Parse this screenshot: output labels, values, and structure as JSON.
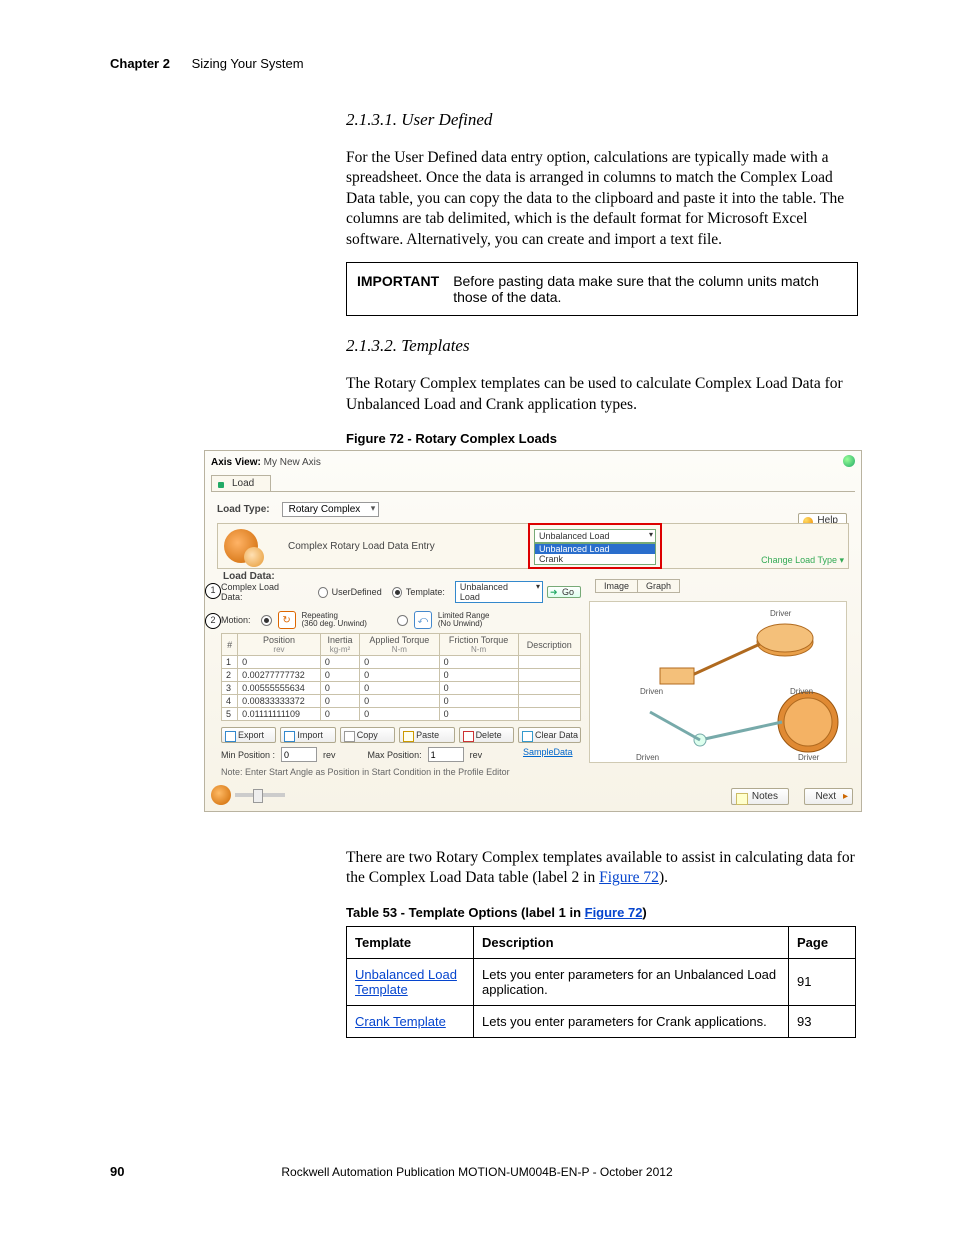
{
  "header": {
    "chapter": "Chapter 2",
    "title": "Sizing Your System"
  },
  "sec1": {
    "num_title": "2.1.3.1.    User Defined",
    "para": "For the User Defined data entry option, calculations are typically made with a spreadsheet. Once the data is arranged in columns to match the Complex Load Data table, you can copy the data to the clipboard and paste it into the table. The columns are tab delimited, which is the default format for Microsoft Excel software. Alternatively, you can create and import a text file."
  },
  "important": {
    "label": "IMPORTANT",
    "text": "Before pasting data make sure that the column units match those of the data."
  },
  "sec2": {
    "num_title": "2.1.3.2.    Templates",
    "para": "The Rotary Complex templates can be used to calculate Complex Load Data for Unbalanced Load and Crank application types."
  },
  "figcap": "Figure 72 - Rotary Complex Loads",
  "screenshot": {
    "axis_view_label": "Axis View:",
    "axis_view_value": "My New Axis",
    "tab_load": "Load",
    "load_type_label": "Load Type:",
    "load_type_value": "Rotary Complex",
    "help_btn": "Help",
    "panel_title": "Complex Rotary Load Data Entry",
    "dd_selected": "Unbalanced Load",
    "dd_opt1": "Unbalanced Load",
    "dd_opt2": "Crank",
    "change_load_type": "Change Load Type",
    "load_data_label": "Load Data:",
    "complex_label": "Complex Load Data:",
    "radio_user": "UserDefined",
    "radio_tmpl": "Template:",
    "tmpl_value": "Unbalanced Load",
    "go_btn": "Go",
    "img_tab": "Image",
    "graph_tab": "Graph",
    "motion_label": "Motion:",
    "repeating_t": "Repeating",
    "repeating_s": "(360 deg. Unwind)",
    "limited_t": "Limited Range",
    "limited_s": "(No Unwind)",
    "cols": {
      "idx": "#",
      "pos": "Position",
      "pos_u": "rev",
      "ine": "Inertia",
      "ine_u": "kg-m²",
      "apt": "Applied Torque",
      "apt_u": "N-m",
      "frt": "Friction Torque",
      "frt_u": "N-m",
      "desc": "Description"
    },
    "rows": [
      {
        "i": "1",
        "p": "0",
        "n": "0",
        "a": "0",
        "f": "0"
      },
      {
        "i": "2",
        "p": "0.00277777732",
        "n": "0",
        "a": "0",
        "f": "0"
      },
      {
        "i": "3",
        "p": "0.00555555634",
        "n": "0",
        "a": "0",
        "f": "0"
      },
      {
        "i": "4",
        "p": "0.00833333372",
        "n": "0",
        "a": "0",
        "f": "0"
      },
      {
        "i": "5",
        "p": "0.01111111109",
        "n": "0",
        "a": "0",
        "f": "0"
      }
    ],
    "btns": {
      "exp": "Export",
      "imp": "Import",
      "cpy": "Copy",
      "pst": "Paste",
      "del": "Delete",
      "clr": "Clear Data"
    },
    "min_pos_label": "Min Position :",
    "min_pos_val": "0",
    "min_unit": "rev",
    "max_pos_label": "Max Position:",
    "max_pos_val": "1",
    "max_unit": "rev",
    "sample": "SampleData",
    "note": "Note: Enter Start Angle as Position in Start Condition in the Profile Editor",
    "illus": {
      "driver": "Driver",
      "driven": "Driven"
    },
    "notes_btn": "Notes",
    "next_btn": "Next"
  },
  "after_fig_para_a": "There are two Rotary Complex templates available to assist in calculating data for the Complex Load Data table (label 2 in ",
  "after_fig_link": "Figure 72",
  "after_fig_para_b": ").",
  "tbl53_caption_a": "Table 53 - Template Options (label 1 in ",
  "tbl53_caption_link": "Figure 72",
  "tbl53_caption_b": ")",
  "tbl53": {
    "h1": "Template",
    "h2": "Description",
    "h3": "Page",
    "r1c1": "Unbalanced Load Template",
    "r1c2": "Lets you enter parameters for an Unbalanced Load application.",
    "r1c3": "91",
    "r2c1": "Crank Template",
    "r2c2": "Lets you enter parameters for Crank applications.",
    "r2c3": "93"
  },
  "footer": {
    "page": "90",
    "pub": "Rockwell Automation Publication MOTION-UM004B-EN-P - October 2012"
  }
}
